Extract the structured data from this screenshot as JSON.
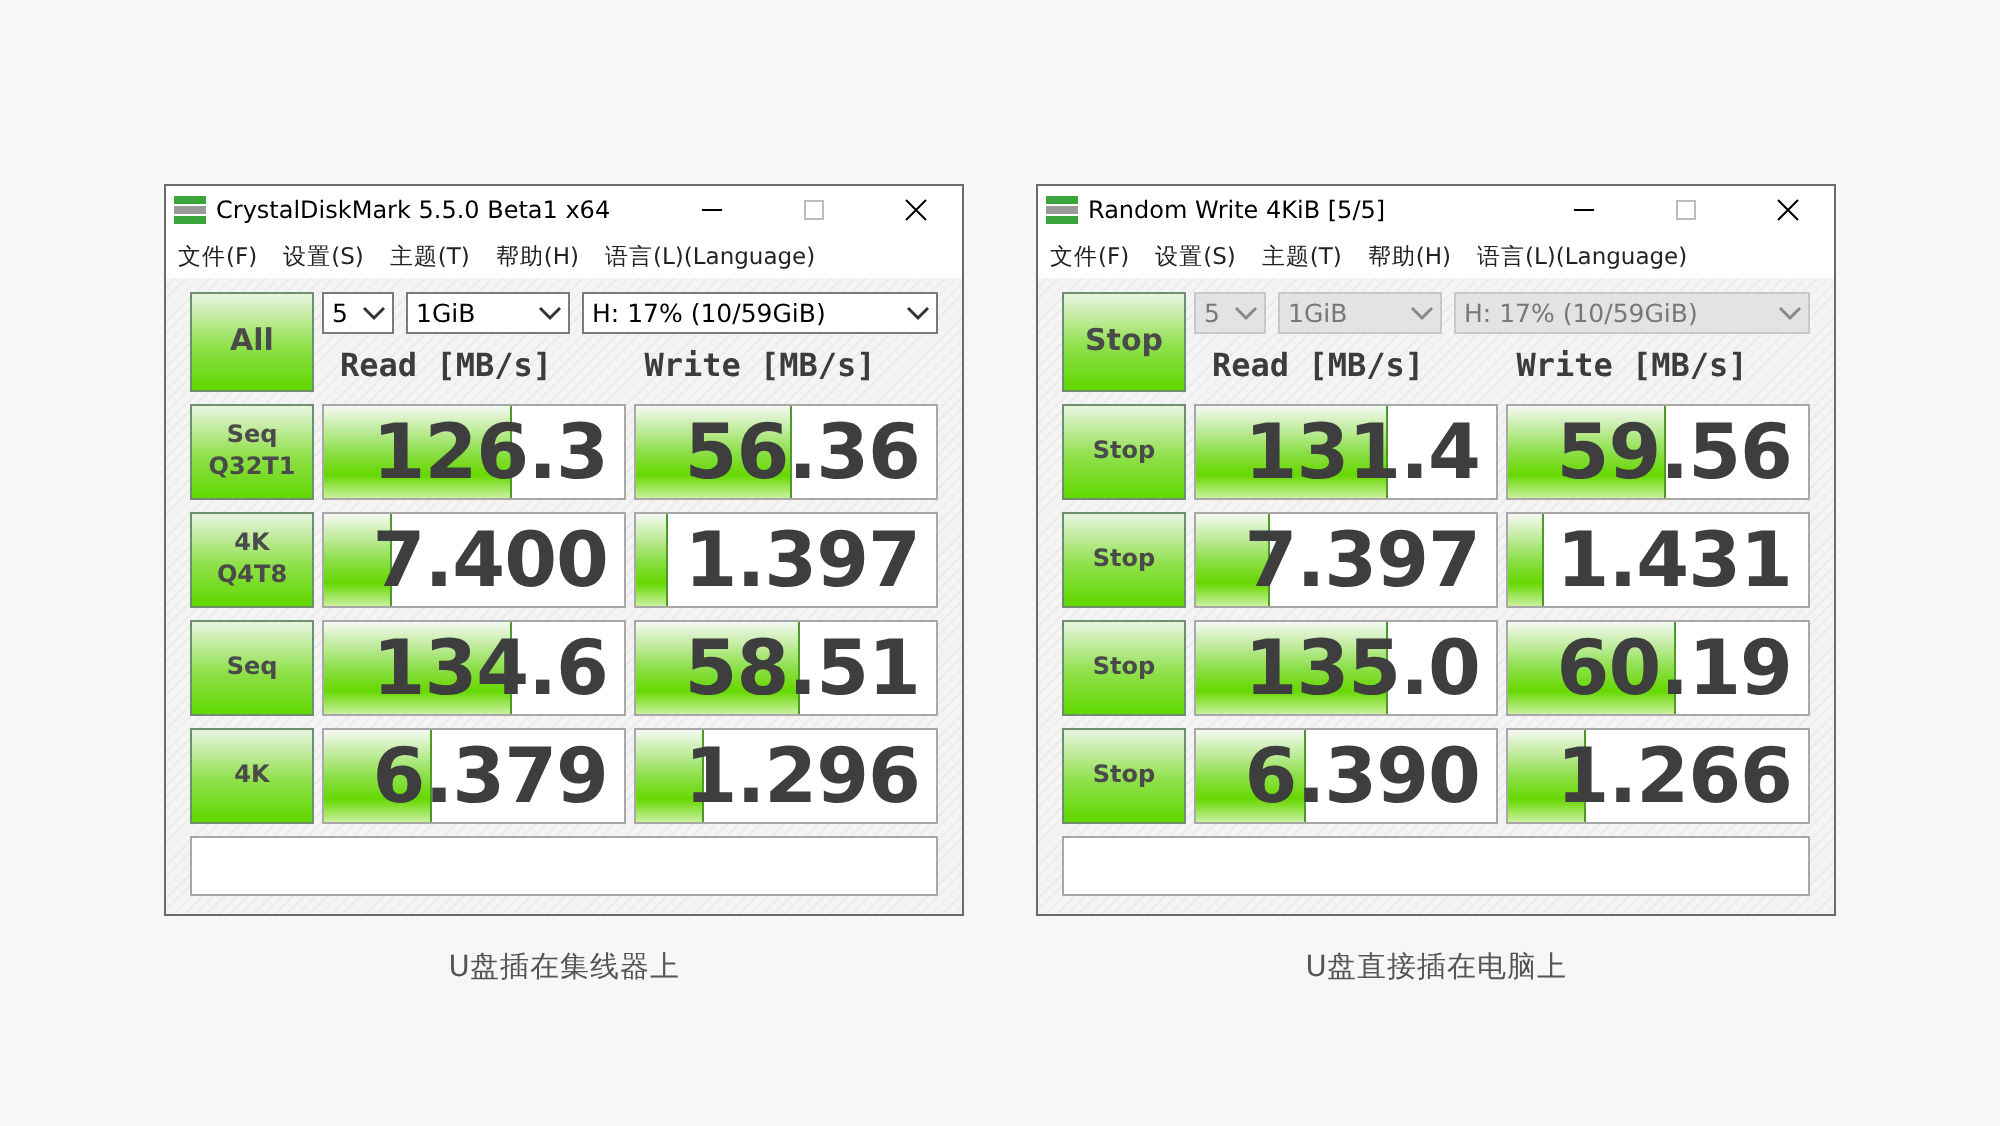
{
  "windows": [
    {
      "title": "CrystalDiskMark 5.5.0 Beta1 x64",
      "menu": [
        "文件(F)",
        "设置(S)",
        "主题(T)",
        "帮助(H)",
        "语言(L)(Language)"
      ],
      "main_button": "All",
      "selectors_disabled": false,
      "count": "5",
      "size": "1GiB",
      "drive": "H: 17% (10/59GiB)",
      "read_header": "Read [MB/s]",
      "write_header": "Write [MB/s]",
      "rows": [
        {
          "label": "Seq\nQ32T1",
          "read": {
            "value": "126.3",
            "level": 0.62
          },
          "write": {
            "value": "56.36",
            "level": 0.51
          }
        },
        {
          "label": "4K\nQ4T8",
          "read": {
            "value": "7.400",
            "level": 0.22
          },
          "write": {
            "value": "1.397",
            "level": 0.1
          }
        },
        {
          "label": "Seq",
          "read": {
            "value": "134.6",
            "level": 0.62
          },
          "write": {
            "value": "58.51",
            "level": 0.54
          }
        },
        {
          "label": "4K",
          "read": {
            "value": "6.379",
            "level": 0.35
          },
          "write": {
            "value": "1.296",
            "level": 0.22
          }
        }
      ],
      "caption": "U盘插在集线器上"
    },
    {
      "title": "Random Write 4KiB [5/5]",
      "menu": [
        "文件(F)",
        "设置(S)",
        "主题(T)",
        "帮助(H)",
        "语言(L)(Language)"
      ],
      "main_button": "Stop",
      "selectors_disabled": true,
      "count": "5",
      "size": "1GiB",
      "drive": "H: 17% (10/59GiB)",
      "read_header": "Read [MB/s]",
      "write_header": "Write [MB/s]",
      "rows": [
        {
          "label": "Stop",
          "read": {
            "value": "131.4",
            "level": 0.63
          },
          "write": {
            "value": "59.56",
            "level": 0.52
          }
        },
        {
          "label": "Stop",
          "read": {
            "value": "7.397",
            "level": 0.24
          },
          "write": {
            "value": "1.431",
            "level": 0.11
          }
        },
        {
          "label": "Stop",
          "read": {
            "value": "135.0",
            "level": 0.63
          },
          "write": {
            "value": "60.19",
            "level": 0.55
          }
        },
        {
          "label": "Stop",
          "read": {
            "value": "6.390",
            "level": 0.36
          },
          "write": {
            "value": "1.266",
            "level": 0.25
          }
        }
      ],
      "caption": "U盘直接插在电脑上"
    }
  ]
}
